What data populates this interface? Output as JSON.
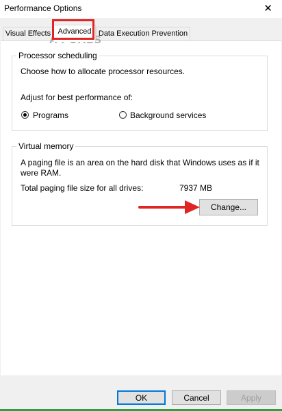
{
  "window": {
    "title": "Performance Options",
    "close_glyph": "✕"
  },
  "tabs": [
    {
      "label": "Visual Effects"
    },
    {
      "label": "Advanced"
    },
    {
      "label": "Data Execution Prevention"
    }
  ],
  "watermark": "A PUALS",
  "processor": {
    "group_label": "Processor scheduling",
    "description": "Choose how to allocate processor resources.",
    "adjust_label": "Adjust for best performance of:",
    "option_programs": "Programs",
    "option_background": "Background services",
    "selected": "Programs"
  },
  "virtual_memory": {
    "group_label": "Virtual memory",
    "description_line1": "A paging file is an area on the hard disk that Windows uses as if it",
    "description_line2": "were RAM.",
    "total_label": "Total paging file size for all drives:",
    "total_value": "7937 MB",
    "change_button": "Change..."
  },
  "footer": {
    "ok": "OK",
    "cancel": "Cancel",
    "apply": "Apply"
  },
  "colors": {
    "annotation_red": "#e02525",
    "focus_blue": "#0078d7"
  },
  "icons": [
    "close-icon",
    "arrow-annotation-icon",
    "appuals-logo-icon"
  ]
}
